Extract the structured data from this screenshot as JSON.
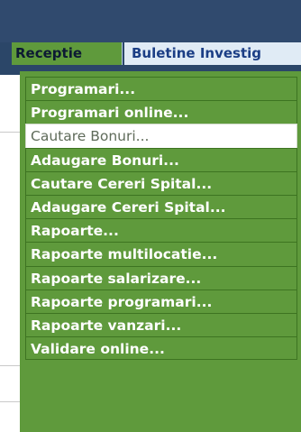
{
  "menubar": {
    "active_item": "Receptie",
    "next_item": "Buletine Investig"
  },
  "dropdown": {
    "items": [
      "Programari...",
      "Programari online...",
      "Cautare Bonuri...",
      "Adaugare Bonuri...",
      "Cautare Cereri Spital...",
      "Adaugare Cereri Spital...",
      "Rapoarte...",
      "Rapoarte multilocatie...",
      "Rapoarte salarizare...",
      "Rapoarte programari...",
      "Rapoarte vanzari...",
      "Validare online..."
    ],
    "hovered_index": 2
  },
  "colors": {
    "menu_green": "#5f9a3c",
    "header_blue": "#2b4668",
    "tab_light": "#e0ebf5",
    "tab_text_blue": "#1b3e85"
  }
}
